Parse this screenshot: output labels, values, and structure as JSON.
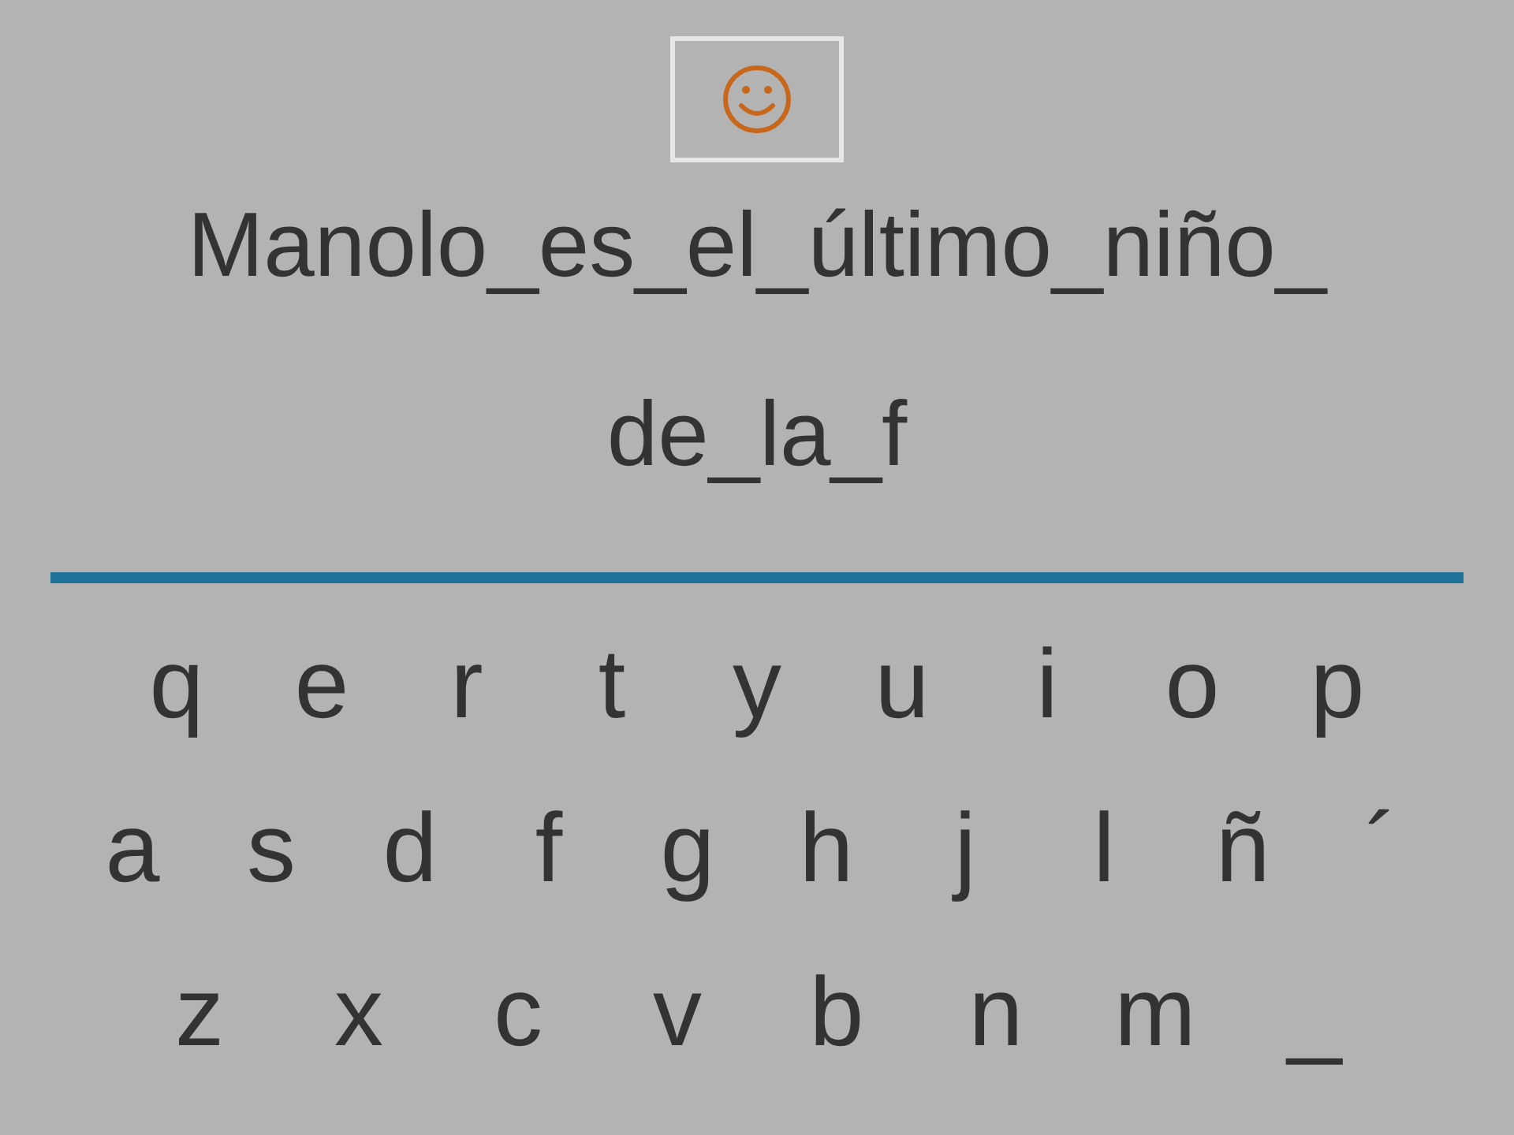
{
  "phrase_lines": [
    "Manolo_es_el_último_niño_",
    "de_la_f"
  ],
  "keyboard_rows": [
    [
      "q",
      "e",
      "r",
      "t",
      "y",
      "u",
      "i",
      "o",
      "p"
    ],
    [
      "a",
      "s",
      "d",
      "f",
      "g",
      "h",
      "j",
      "l",
      "ñ",
      "´"
    ],
    [
      "z",
      "x",
      "c",
      "v",
      "b",
      "n",
      "m",
      "_"
    ]
  ]
}
